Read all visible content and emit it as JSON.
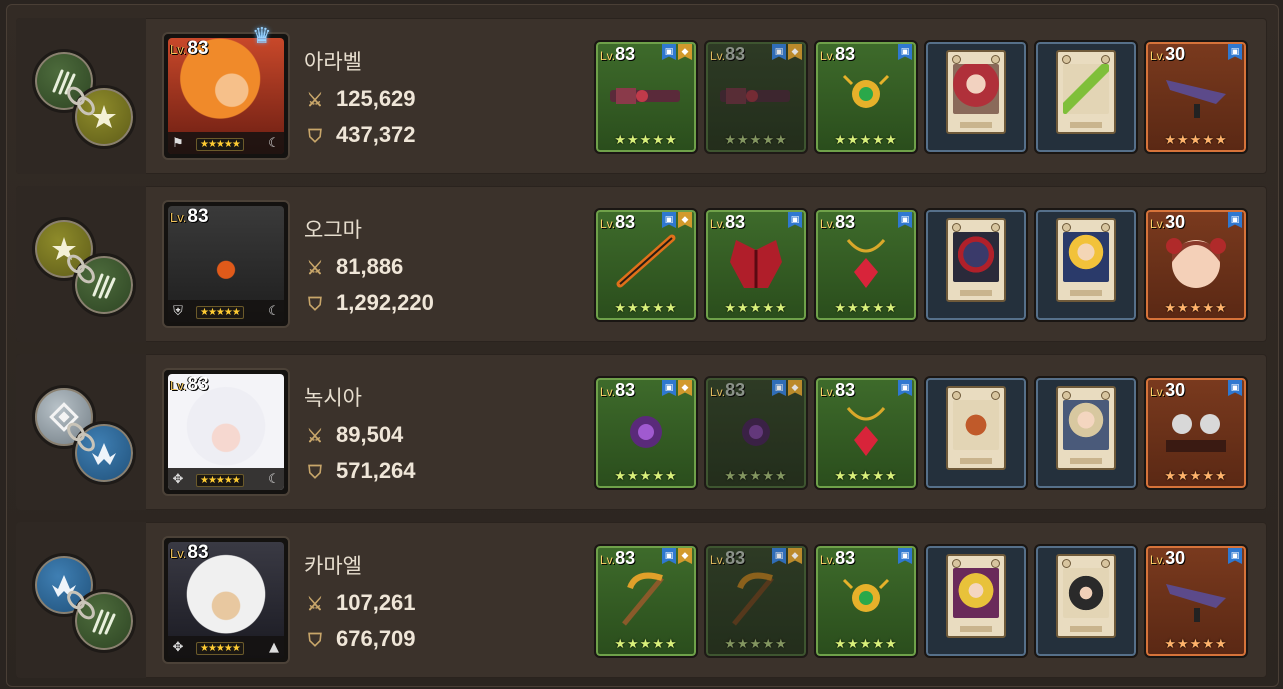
{
  "colors": {
    "panel": "#3b322b",
    "rare_green": "#6fa14a",
    "legend_orange": "#d6733a",
    "card_navy": "#56708a",
    "badge_blue": "#2f78d0",
    "badge_gold": "#d29a2c"
  },
  "heroes": [
    {
      "name": "아라벨",
      "level": "83",
      "attack": "125,629",
      "hp": "437,372",
      "leader_crown": true,
      "link_icons": [
        "claw-icon",
        "star-icon"
      ],
      "portrait_stars": "★★★★★",
      "gear": [
        {
          "type": "weapon",
          "level": "83",
          "stars": "★★★★★",
          "rarity": "green"
        },
        {
          "type": "weapon-offhand",
          "level": "83",
          "stars": "★★★★★",
          "rarity": "dim"
        },
        {
          "type": "accessory",
          "level": "83",
          "stars": "★★★★★",
          "rarity": "green"
        },
        {
          "type": "card",
          "rarity": "navy"
        },
        {
          "type": "card",
          "rarity": "navy"
        },
        {
          "type": "costume",
          "level": "30",
          "stars": "★★★★★",
          "rarity": "orange"
        }
      ]
    },
    {
      "name": "오그마",
      "level": "83",
      "attack": "81,886",
      "hp": "1,292,220",
      "leader_crown": false,
      "link_icons": [
        "star-icon",
        "claw-icon"
      ],
      "portrait_stars": "★★★★★",
      "gear": [
        {
          "type": "weapon",
          "level": "83",
          "stars": "★★★★★",
          "rarity": "green"
        },
        {
          "type": "armor",
          "level": "83",
          "stars": "★★★★★",
          "rarity": "green"
        },
        {
          "type": "accessory",
          "level": "83",
          "stars": "★★★★★",
          "rarity": "green"
        },
        {
          "type": "card",
          "rarity": "navy"
        },
        {
          "type": "card",
          "rarity": "navy"
        },
        {
          "type": "costume",
          "level": "30",
          "stars": "★★★★★",
          "rarity": "orange"
        }
      ]
    },
    {
      "name": "녹시아",
      "level": "83",
      "attack": "89,504",
      "hp": "571,264",
      "leader_crown": false,
      "link_icons": [
        "rune-icon",
        "wing-icon"
      ],
      "portrait_stars": "★★★★★",
      "gear": [
        {
          "type": "orb",
          "level": "83",
          "stars": "★★★★★",
          "rarity": "green"
        },
        {
          "type": "orb-offhand",
          "level": "83",
          "stars": "★★★★★",
          "rarity": "dim"
        },
        {
          "type": "accessory",
          "level": "83",
          "stars": "★★★★★",
          "rarity": "green"
        },
        {
          "type": "card",
          "rarity": "navy"
        },
        {
          "type": "card",
          "rarity": "navy"
        },
        {
          "type": "costume",
          "level": "30",
          "stars": "★★★★★",
          "rarity": "orange"
        }
      ]
    },
    {
      "name": "카마엘",
      "level": "83",
      "attack": "107,261",
      "hp": "676,709",
      "leader_crown": false,
      "link_icons": [
        "wing-icon",
        "claw-icon"
      ],
      "portrait_stars": "★★★★★",
      "gear": [
        {
          "type": "scythe",
          "level": "83",
          "stars": "★★★★★",
          "rarity": "green"
        },
        {
          "type": "scythe-offhand",
          "level": "83",
          "stars": "★★★★★",
          "rarity": "dim"
        },
        {
          "type": "accessory",
          "level": "83",
          "stars": "★★★★★",
          "rarity": "green"
        },
        {
          "type": "card",
          "rarity": "navy"
        },
        {
          "type": "card",
          "rarity": "navy"
        },
        {
          "type": "costume",
          "level": "30",
          "stars": "★★★★★",
          "rarity": "orange"
        }
      ]
    }
  ]
}
